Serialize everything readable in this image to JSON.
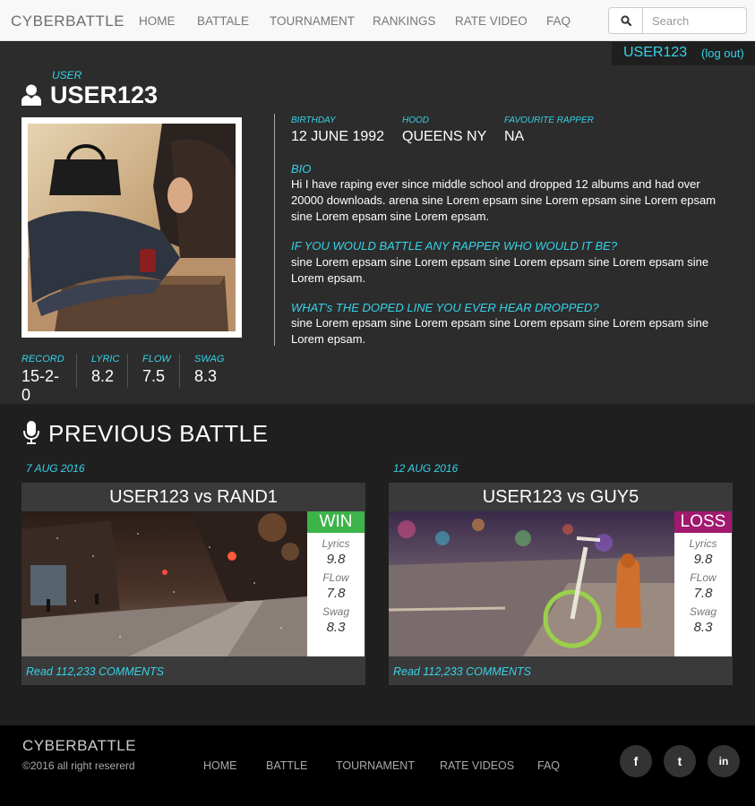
{
  "navbar": {
    "brand": "CYBERBATTLE",
    "items": [
      "HOME",
      "BATTALE",
      "TOURNAMENT",
      "RANKINGS",
      "RATE VIDEO",
      "FAQ"
    ],
    "search_placeholder": "Search"
  },
  "session": {
    "username": "USER123",
    "logout": "(log out)"
  },
  "profile": {
    "user_label": "USER",
    "username": "USER123",
    "birthday_label": "BIRTHDAY",
    "birthday": "12 JUNE 1992",
    "hood_label": "HOOD",
    "hood": "QUEENS NY",
    "rapper_label": "FAVOURITE RAPPER",
    "rapper": "NA",
    "bio_title": "BIO",
    "bio": "Hi I have raping ever since middle school and dropped 12 albums and had over 20000 downloads. arena sine Lorem epsam sine Lorem epsam sine Lorem epsam sine Lorem epsam sine Lorem epsam.",
    "q1_title": "IF YOU WOULD BATTLE ANY RAPPER WHO WOULD IT BE?",
    "q1_text": "sine Lorem epsam sine Lorem epsam sine Lorem epsam sine Lorem epsam sine Lorem epsam.",
    "q2_title": "WHAT's THE DOPED LINE YOU EVER HEAR DROPPED?",
    "q2_text": "sine Lorem epsam sine Lorem epsam sine Lorem epsam sine Lorem epsam sine Lorem epsam.",
    "stats": [
      {
        "label": "RECORD",
        "value": "15-2-0"
      },
      {
        "label": "LYRIC",
        "value": "8.2"
      },
      {
        "label": "FLOW",
        "value": "7.5"
      },
      {
        "label": "SWAG",
        "value": "8.3"
      }
    ]
  },
  "previous_battle": {
    "title": "PREVIOUS BATTLE",
    "battles": [
      {
        "date": "7 AUG 2016",
        "title": "USER123 vs RAND1",
        "result": "WIN",
        "lyrics_label": "Lyrics",
        "lyrics": "9.8",
        "flow_label": "FLow",
        "flow": "7.8",
        "swag_label": "Swag",
        "swag": "8.3",
        "comments": "Read 112,233 COMMENTS"
      },
      {
        "date": "12 AUG 2016",
        "title": "USER123 vs GUY5",
        "result": "LOSS",
        "lyrics_label": "Lyrics",
        "lyrics": "9.8",
        "flow_label": "FLow",
        "flow": "7.8",
        "swag_label": "Swag",
        "swag": "8.3",
        "comments": "Read 112,233 COMMENTS"
      }
    ]
  },
  "footer": {
    "brand": "CYBERBATTLE",
    "copyright": "©2016 all right resererd",
    "links": [
      "HOME",
      "BATTLE",
      "TOURNAMENT",
      "RATE VIDEOS",
      "FAQ"
    ],
    "social": [
      {
        "icon": "facebook-icon",
        "glyph": "f"
      },
      {
        "icon": "twitter-icon",
        "glyph": "t"
      },
      {
        "icon": "linkedin-icon",
        "glyph": "in"
      }
    ]
  },
  "colors": {
    "accent": "#35d3e8",
    "win": "#3cb44a",
    "loss": "#a0196e",
    "profile_bg": "#2c2c2c",
    "page_bg": "#1f1f1f",
    "footer_bg": "#000000"
  }
}
